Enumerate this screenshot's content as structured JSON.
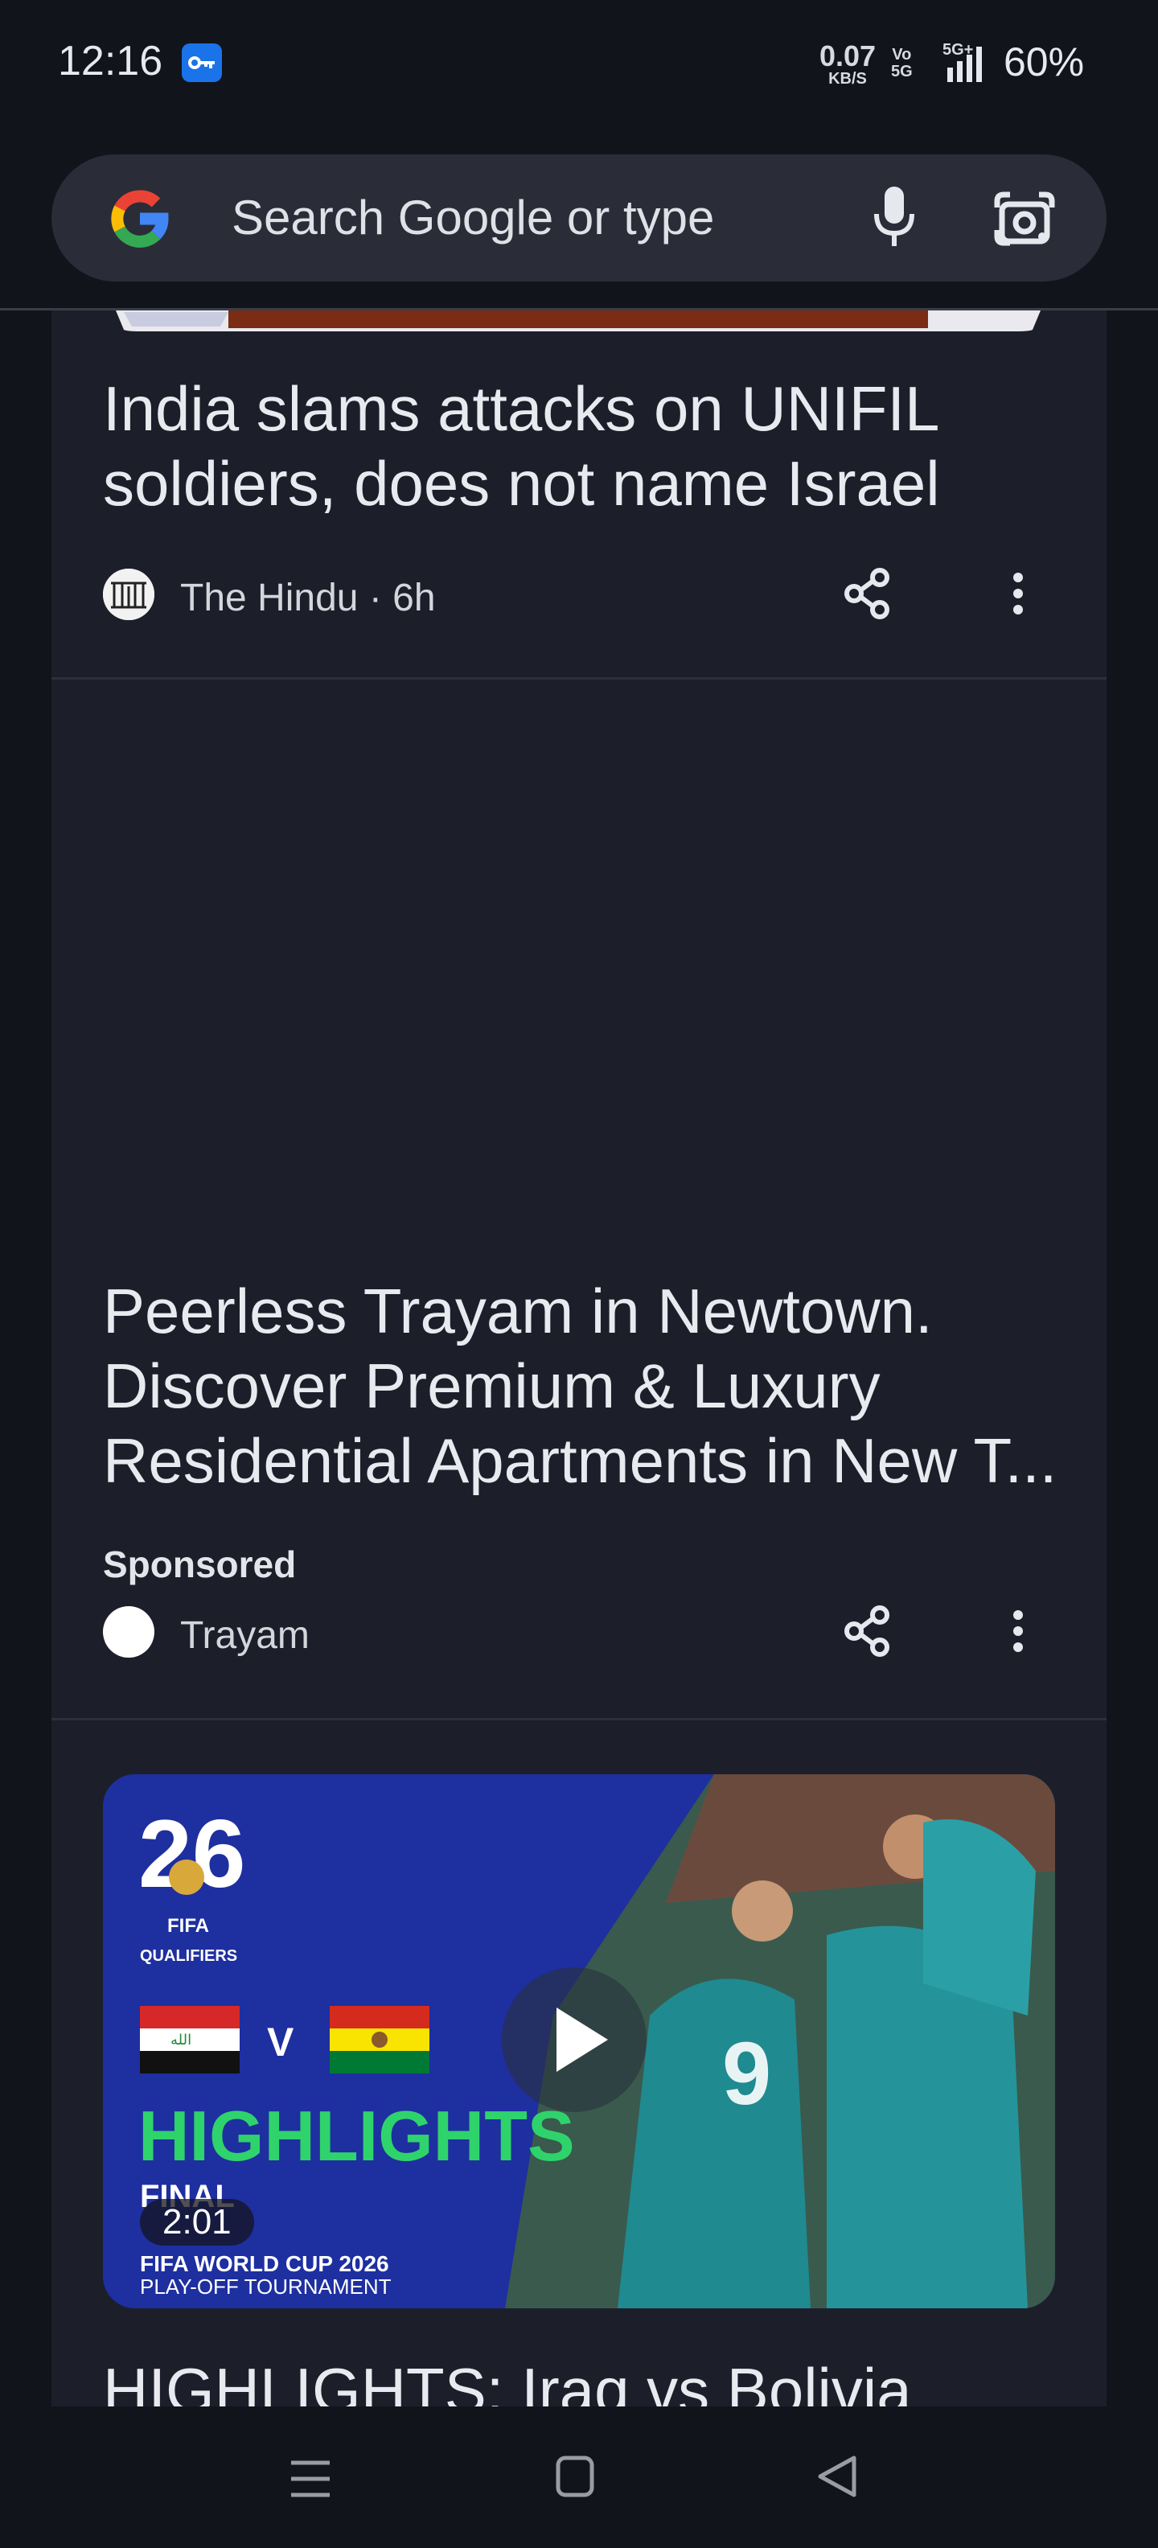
{
  "status_bar": {
    "time": "12:16",
    "net_speed_value": "0.07",
    "net_speed_unit": "KB/S",
    "volte_top": "Vo",
    "volte_bottom": "5G",
    "network": "5G+",
    "battery": "60%"
  },
  "search": {
    "placeholder": "Search Google or type"
  },
  "feed": {
    "cards": [
      {
        "headline": "India slams attacks on UNIFIL soldiers, does not name Israel",
        "source": "The Hindu",
        "time": "6h"
      },
      {
        "headline": "Peerless Trayam in Newtown. Discover Premium & Luxury Residential Apartments in New T...",
        "label": "Sponsored",
        "source": "Trayam"
      },
      {
        "video": {
          "duration": "2:01",
          "thumbnail_texts": {
            "badge_number": "26",
            "fifa": "FIFA",
            "qualifiers": "QUALIFIERS",
            "versus": "V",
            "highlights": "HIGHLIGHTS",
            "final": "FINAL",
            "tournament_line1": "FIFA WORLD CUP 2026",
            "tournament_line2": "PLAY-OFF TOURNAMENT",
            "jersey_number": "9"
          }
        },
        "headline": "HIGHLIGHTS: Iraq vs Bolivia"
      }
    ]
  },
  "colors": {
    "background": "#12141c",
    "card": "#1c1f2a",
    "search_bar": "#2a2d38",
    "video_bg": "#1e2fa0",
    "highlights_green": "#2fd36b"
  }
}
